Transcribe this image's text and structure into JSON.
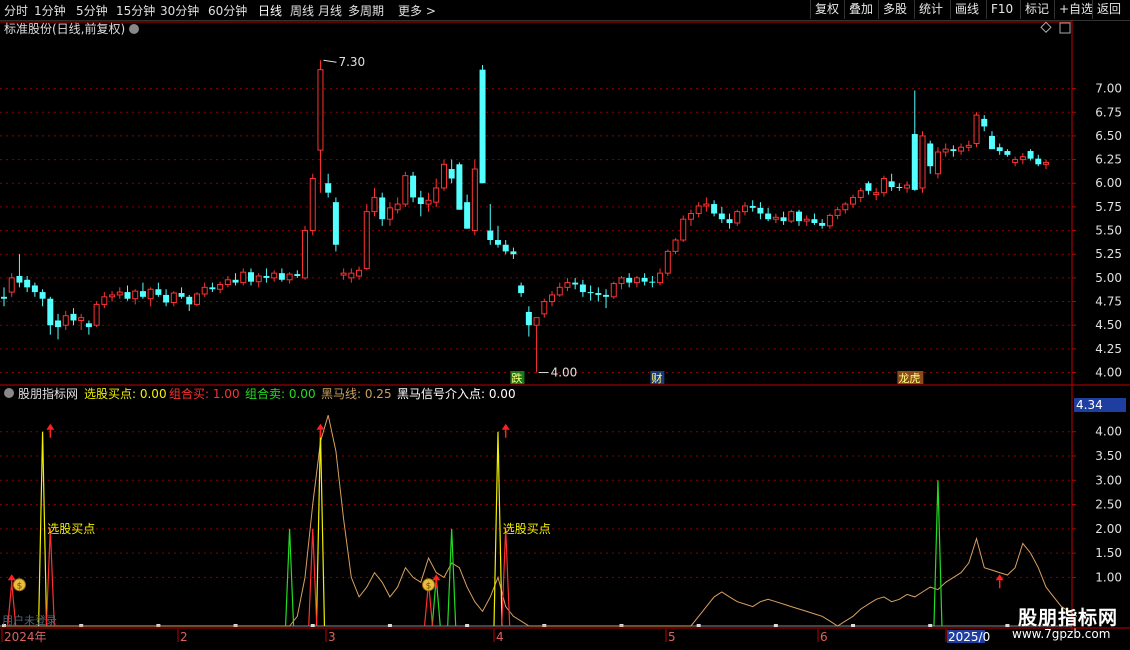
{
  "toolbar": {
    "periods": [
      "分时",
      "1分钟",
      "5分钟",
      "15分钟",
      "30分钟",
      "60分钟",
      "日线",
      "周线",
      "月线",
      "多周期",
      "更多 >"
    ],
    "active_period": "日线",
    "right_buttons": [
      "复权",
      "叠加",
      "多股",
      "统计",
      "画线",
      "F10",
      "标记",
      "+自选",
      "返回"
    ]
  },
  "main_panel": {
    "title": "标准股份(日线,前复权)",
    "high_label": "7.30",
    "low_label": "4.00",
    "event_tags": [
      "跌",
      "财",
      "龙虎"
    ],
    "price_axis": [
      "7.00",
      "6.75",
      "6.50",
      "6.25",
      "6.00",
      "5.75",
      "5.50",
      "5.25",
      "5.00",
      "4.75",
      "4.50",
      "4.25",
      "4.00"
    ]
  },
  "indicator_panel": {
    "name": "股朋指标网",
    "params": [
      {
        "label": "选股买点:",
        "value": "0.00",
        "color": "#f0f000"
      },
      {
        "label": "组合买:",
        "value": "1.00",
        "color": "#ff3030"
      },
      {
        "label": "组合卖:",
        "value": "0.00",
        "color": "#22dd22"
      },
      {
        "label": "黑马线:",
        "value": "0.25",
        "color": "#c8a060"
      },
      {
        "label": "黑马信号介入点:",
        "value": "0.00",
        "color": "#ffffff"
      }
    ],
    "value_box": "4.34",
    "axis": [
      "4.00",
      "3.50",
      "3.00",
      "2.50",
      "2.00",
      "1.50",
      "1.00"
    ],
    "buy_label": "选股买点",
    "footer_left": "用户未登录"
  },
  "date_axis": [
    "2024年",
    "2",
    "3",
    "4",
    "5",
    "6",
    "2025/0"
  ],
  "watermark": {
    "title": "股朋指标网",
    "url": "www.7gpzb.com"
  },
  "colors": {
    "up": "#ff3232",
    "down": "#54ffff",
    "grid": "#8b0000",
    "axis": "#c00000"
  },
  "candles": [
    [
      4.8,
      4.9,
      4.7,
      4.78
    ],
    [
      4.85,
      5.05,
      4.8,
      5.0
    ],
    [
      5.02,
      5.25,
      4.9,
      4.95
    ],
    [
      4.98,
      5.02,
      4.85,
      4.9
    ],
    [
      4.92,
      4.95,
      4.8,
      4.85
    ],
    [
      4.85,
      4.88,
      4.7,
      4.78
    ],
    [
      4.78,
      4.8,
      4.4,
      4.5
    ],
    [
      4.55,
      4.62,
      4.35,
      4.48
    ],
    [
      4.5,
      4.65,
      4.45,
      4.6
    ],
    [
      4.62,
      4.68,
      4.5,
      4.55
    ],
    [
      4.55,
      4.62,
      4.45,
      4.58
    ],
    [
      4.52,
      4.55,
      4.4,
      4.48
    ],
    [
      4.5,
      4.75,
      4.48,
      4.72
    ],
    [
      4.72,
      4.85,
      4.68,
      4.8
    ],
    [
      4.8,
      4.86,
      4.75,
      4.82
    ],
    [
      4.82,
      4.9,
      4.78,
      4.85
    ],
    [
      4.85,
      4.92,
      4.76,
      4.78
    ],
    [
      4.78,
      4.88,
      4.72,
      4.86
    ],
    [
      4.86,
      4.95,
      4.78,
      4.8
    ],
    [
      4.78,
      4.9,
      4.7,
      4.88
    ],
    [
      4.88,
      4.95,
      4.8,
      4.82
    ],
    [
      4.82,
      4.88,
      4.7,
      4.74
    ],
    [
      4.74,
      4.86,
      4.7,
      4.84
    ],
    [
      4.84,
      4.9,
      4.78,
      4.8
    ],
    [
      4.8,
      4.82,
      4.65,
      4.72
    ],
    [
      4.72,
      4.85,
      4.7,
      4.83
    ],
    [
      4.83,
      4.95,
      4.8,
      4.9
    ],
    [
      4.9,
      4.95,
      4.85,
      4.88
    ],
    [
      4.88,
      4.96,
      4.84,
      4.93
    ],
    [
      4.93,
      5.02,
      4.9,
      4.98
    ],
    [
      4.98,
      5.05,
      4.92,
      4.95
    ],
    [
      4.95,
      5.1,
      4.92,
      5.06
    ],
    [
      5.06,
      5.1,
      4.92,
      4.96
    ],
    [
      4.96,
      5.05,
      4.9,
      5.02
    ],
    [
      5.02,
      5.1,
      4.95,
      5.0
    ],
    [
      5.0,
      5.08,
      4.96,
      5.05
    ],
    [
      5.05,
      5.1,
      4.96,
      4.98
    ],
    [
      4.98,
      5.06,
      4.94,
      5.04
    ],
    [
      5.04,
      5.08,
      5.0,
      5.02
    ],
    [
      5.0,
      5.55,
      4.98,
      5.5
    ],
    [
      5.5,
      6.1,
      5.45,
      6.05
    ],
    [
      6.35,
      7.3,
      5.9,
      7.2
    ],
    [
      6.0,
      6.1,
      5.85,
      5.9
    ],
    [
      5.8,
      5.85,
      5.28,
      5.35
    ],
    [
      5.03,
      5.1,
      4.98,
      5.05
    ],
    [
      5.0,
      5.1,
      4.95,
      5.05
    ],
    [
      5.02,
      5.12,
      4.98,
      5.08
    ],
    [
      5.1,
      5.78,
      5.08,
      5.7
    ],
    [
      5.7,
      5.95,
      5.65,
      5.85
    ],
    [
      5.85,
      5.9,
      5.55,
      5.62
    ],
    [
      5.62,
      5.8,
      5.55,
      5.74
    ],
    [
      5.72,
      5.85,
      5.68,
      5.78
    ],
    [
      5.78,
      6.12,
      5.75,
      6.08
    ],
    [
      6.08,
      6.12,
      5.8,
      5.85
    ],
    [
      5.85,
      5.92,
      5.65,
      5.78
    ],
    [
      5.78,
      5.9,
      5.7,
      5.82
    ],
    [
      5.8,
      6.05,
      5.75,
      5.95
    ],
    [
      5.95,
      6.25,
      5.92,
      6.2
    ],
    [
      6.15,
      6.25,
      6.0,
      6.05
    ],
    [
      6.2,
      6.22,
      5.9,
      5.72
    ],
    [
      5.8,
      5.88,
      5.52,
      5.52
    ],
    [
      5.5,
      6.25,
      5.45,
      6.15
    ],
    [
      7.2,
      7.25,
      6.0,
      6.0
    ],
    [
      5.5,
      5.78,
      5.35,
      5.4
    ],
    [
      5.4,
      5.55,
      5.32,
      5.35
    ],
    [
      5.35,
      5.4,
      5.25,
      5.28
    ],
    [
      5.28,
      5.32,
      5.2,
      5.25
    ],
    [
      4.92,
      4.95,
      4.8,
      4.84
    ],
    [
      4.64,
      4.7,
      4.38,
      4.5
    ],
    [
      4.5,
      4.55,
      4.0,
      4.58
    ],
    [
      4.62,
      4.78,
      4.58,
      4.75
    ],
    [
      4.75,
      4.86,
      4.7,
      4.82
    ],
    [
      4.82,
      4.95,
      4.8,
      4.9
    ],
    [
      4.9,
      5.0,
      4.86,
      4.95
    ],
    [
      4.95,
      5.0,
      4.88,
      4.93
    ],
    [
      4.93,
      4.98,
      4.8,
      4.85
    ],
    [
      4.85,
      4.92,
      4.76,
      4.84
    ],
    [
      4.84,
      4.9,
      4.75,
      4.82
    ],
    [
      4.82,
      4.88,
      4.68,
      4.8
    ],
    [
      4.8,
      4.96,
      4.78,
      4.94
    ],
    [
      4.94,
      5.02,
      4.88,
      5.0
    ],
    [
      5.0,
      5.05,
      4.9,
      4.95
    ],
    [
      4.95,
      5.02,
      4.9,
      5.0
    ],
    [
      5.0,
      5.05,
      4.92,
      4.96
    ],
    [
      4.96,
      5.02,
      4.9,
      4.95
    ],
    [
      4.95,
      5.1,
      4.92,
      5.05
    ],
    [
      5.05,
      5.3,
      5.02,
      5.28
    ],
    [
      5.28,
      5.42,
      5.25,
      5.4
    ],
    [
      5.4,
      5.66,
      5.38,
      5.62
    ],
    [
      5.62,
      5.72,
      5.55,
      5.68
    ],
    [
      5.68,
      5.8,
      5.64,
      5.76
    ],
    [
      5.76,
      5.85,
      5.7,
      5.78
    ],
    [
      5.78,
      5.82,
      5.65,
      5.68
    ],
    [
      5.68,
      5.75,
      5.58,
      5.62
    ],
    [
      5.62,
      5.68,
      5.52,
      5.58
    ],
    [
      5.58,
      5.72,
      5.55,
      5.7
    ],
    [
      5.7,
      5.8,
      5.66,
      5.76
    ],
    [
      5.76,
      5.82,
      5.7,
      5.74
    ],
    [
      5.74,
      5.8,
      5.62,
      5.68
    ],
    [
      5.68,
      5.74,
      5.6,
      5.62
    ],
    [
      5.62,
      5.68,
      5.58,
      5.64
    ],
    [
      5.64,
      5.7,
      5.56,
      5.6
    ],
    [
      5.6,
      5.72,
      5.58,
      5.7
    ],
    [
      5.7,
      5.72,
      5.55,
      5.6
    ],
    [
      5.6,
      5.66,
      5.55,
      5.62
    ],
    [
      5.62,
      5.68,
      5.56,
      5.58
    ],
    [
      5.58,
      5.62,
      5.52,
      5.55
    ],
    [
      5.55,
      5.68,
      5.52,
      5.66
    ],
    [
      5.66,
      5.75,
      5.62,
      5.72
    ],
    [
      5.72,
      5.8,
      5.68,
      5.78
    ],
    [
      5.78,
      5.88,
      5.74,
      5.85
    ],
    [
      5.85,
      5.95,
      5.8,
      5.92
    ],
    [
      6.0,
      6.02,
      5.88,
      5.92
    ],
    [
      5.88,
      5.95,
      5.82,
      5.9
    ],
    [
      5.9,
      6.08,
      5.86,
      6.05
    ],
    [
      6.02,
      6.1,
      5.92,
      5.96
    ],
    [
      5.96,
      6.0,
      5.92,
      5.95
    ],
    [
      5.95,
      6.02,
      5.9,
      5.98
    ],
    [
      6.52,
      6.98,
      5.92,
      5.93
    ],
    [
      5.95,
      6.55,
      5.9,
      6.5
    ],
    [
      6.42,
      6.45,
      6.1,
      6.18
    ],
    [
      6.1,
      6.38,
      6.05,
      6.33
    ],
    [
      6.33,
      6.42,
      6.28,
      6.36
    ],
    [
      6.36,
      6.4,
      6.28,
      6.34
    ],
    [
      6.34,
      6.42,
      6.3,
      6.38
    ],
    [
      6.38,
      6.45,
      6.34,
      6.4
    ],
    [
      6.42,
      6.75,
      6.38,
      6.72
    ],
    [
      6.68,
      6.72,
      6.55,
      6.6
    ],
    [
      6.5,
      6.55,
      6.38,
      6.36
    ],
    [
      6.38,
      6.42,
      6.3,
      6.34
    ],
    [
      6.34,
      6.36,
      6.28,
      6.3
    ],
    [
      6.22,
      6.28,
      6.18,
      6.25
    ],
    [
      6.25,
      6.32,
      6.2,
      6.28
    ],
    [
      6.34,
      6.36,
      6.24,
      6.26
    ],
    [
      6.26,
      6.3,
      6.18,
      6.2
    ],
    [
      6.2,
      6.25,
      6.15,
      6.22
    ]
  ],
  "indicator_series": {
    "heima": [
      0,
      0,
      0,
      0,
      0,
      0,
      0,
      0,
      0,
      0,
      0,
      0,
      0,
      0,
      0,
      0,
      0,
      0,
      0,
      0,
      0,
      0,
      0,
      0,
      0,
      0,
      0,
      0,
      0,
      0,
      0,
      0,
      0,
      0,
      0,
      0,
      0,
      0,
      0.2,
      1.0,
      2.5,
      3.8,
      4.34,
      3.6,
      2.2,
      1.0,
      0.6,
      0.8,
      1.1,
      0.9,
      0.6,
      0.8,
      1.2,
      1.0,
      0.9,
      1.4,
      1.1,
      1.0,
      1.3,
      1.2,
      0.8,
      0.5,
      0.3,
      0.6,
      1.0,
      0.4,
      0.2,
      0.1,
      0,
      0,
      0,
      0,
      0,
      0,
      0,
      0,
      0,
      0,
      0,
      0,
      0,
      0,
      0,
      0,
      0,
      0,
      0,
      0,
      0,
      0,
      0.2,
      0.4,
      0.6,
      0.7,
      0.6,
      0.5,
      0.45,
      0.4,
      0.5,
      0.55,
      0.5,
      0.45,
      0.4,
      0.35,
      0.3,
      0.25,
      0.2,
      0.1,
      0,
      0.1,
      0.2,
      0.35,
      0.45,
      0.55,
      0.6,
      0.5,
      0.55,
      0.65,
      0.6,
      0.7,
      0.8,
      0.75,
      0.9,
      1.0,
      1.1,
      1.3,
      1.8,
      1.2,
      1.15,
      1.1,
      1.05,
      1.2,
      1.7,
      1.5,
      1.2,
      0.8,
      0.6,
      0.4,
      0.3,
      0.2
    ],
    "buy_spikes": [
      [
        5,
        4.0
      ],
      [
        41,
        4.0
      ],
      [
        64,
        4.0
      ]
    ],
    "sell_spikes": [
      [
        37,
        2.0
      ],
      [
        56,
        1.0
      ],
      [
        58,
        2.0
      ],
      [
        121,
        3.0
      ]
    ],
    "red_spikes": [
      [
        1,
        0.9
      ],
      [
        6,
        2.0
      ],
      [
        40,
        2.0
      ],
      [
        55,
        0.9
      ],
      [
        65,
        2.0
      ]
    ],
    "red_arrows": [
      [
        1,
        0.9
      ],
      [
        6,
        4.0
      ],
      [
        41,
        4.0
      ],
      [
        56,
        0.9
      ],
      [
        65,
        4.0
      ],
      [
        129,
        0.9
      ]
    ],
    "bag_icons": [
      [
        2,
        0.85
      ],
      [
        55,
        0.85
      ]
    ],
    "label_positions": [
      6,
      65
    ]
  }
}
